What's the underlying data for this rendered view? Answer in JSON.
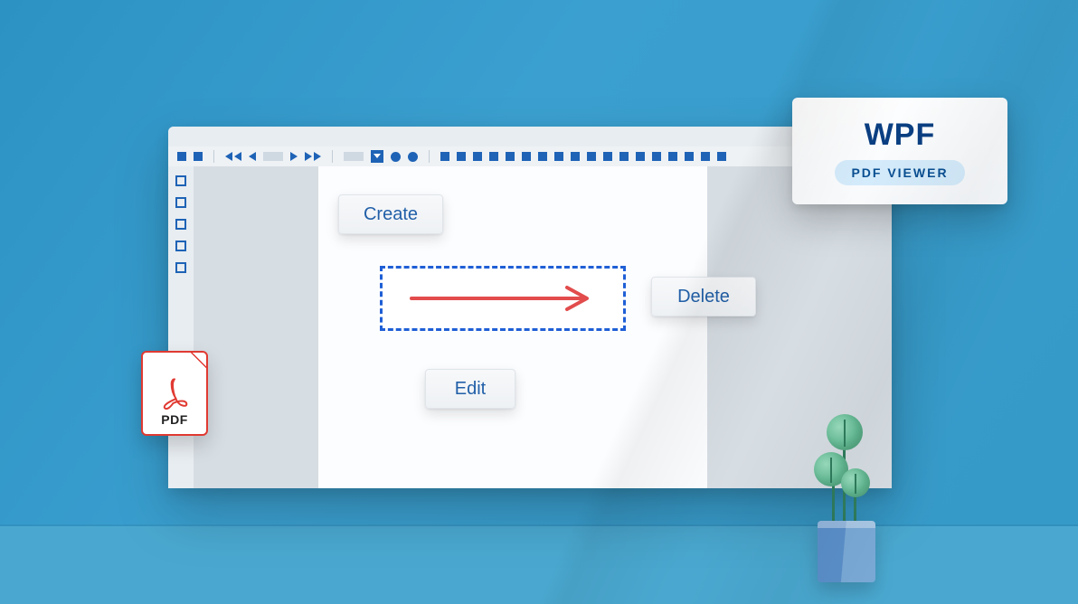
{
  "buttons": {
    "create": "Create",
    "edit": "Edit",
    "delete": "Delete"
  },
  "callout": {
    "title": "WPF",
    "subtitle": "PDF VIEWER"
  },
  "pdf_badge": {
    "label": "PDF"
  },
  "icons": {
    "acrobat": "acrobat-logo-icon",
    "arrow": "right-arrow-icon"
  },
  "colors": {
    "brand_blue": "#1e63b6",
    "selection_blue": "#1f5fd6",
    "arrow_red": "#e24c4c",
    "pdf_red": "#e03a32",
    "bg_blue": "#359ac7"
  }
}
